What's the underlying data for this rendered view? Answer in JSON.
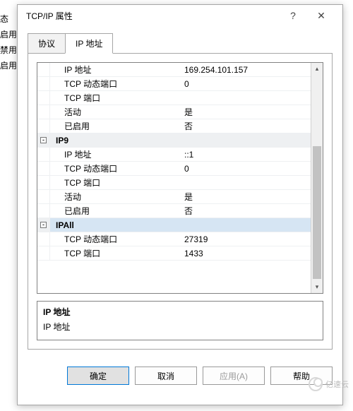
{
  "background_lines": [
    "态",
    "启用",
    "禁用",
    "启用"
  ],
  "dialog": {
    "title": "TCP/IP 属性",
    "tabs": [
      "协议",
      "IP 地址"
    ],
    "active_tab": 1,
    "grid_rows": [
      {
        "type": "data",
        "indent": true,
        "label": "IP 地址",
        "value": "169.254.101.157"
      },
      {
        "type": "data",
        "indent": true,
        "label": "TCP 动态端口",
        "value": "0"
      },
      {
        "type": "data",
        "indent": true,
        "label": "TCP 端口",
        "value": ""
      },
      {
        "type": "data",
        "indent": true,
        "label": "活动",
        "value": "是"
      },
      {
        "type": "data",
        "indent": true,
        "label": "已启用",
        "value": "否"
      },
      {
        "type": "section",
        "label": "IP9",
        "value": ""
      },
      {
        "type": "data",
        "indent": true,
        "label": "IP 地址",
        "value": "::1"
      },
      {
        "type": "data",
        "indent": true,
        "label": "TCP 动态端口",
        "value": "0"
      },
      {
        "type": "data",
        "indent": true,
        "label": "TCP 端口",
        "value": ""
      },
      {
        "type": "data",
        "indent": true,
        "label": "活动",
        "value": "是"
      },
      {
        "type": "data",
        "indent": true,
        "label": "已启用",
        "value": "否"
      },
      {
        "type": "section",
        "selected": true,
        "label": "IPAll",
        "value": ""
      },
      {
        "type": "data",
        "indent": true,
        "label": "TCP 动态端口",
        "value": "27319"
      },
      {
        "type": "data",
        "indent": true,
        "label": "TCP 端口",
        "value": "1433"
      }
    ],
    "description": {
      "title": "IP 地址",
      "body": "IP 地址"
    },
    "buttons": {
      "ok": "确定",
      "cancel": "取消",
      "apply": "应用(A)",
      "help": "帮助"
    }
  },
  "watermark": "亿速云"
}
